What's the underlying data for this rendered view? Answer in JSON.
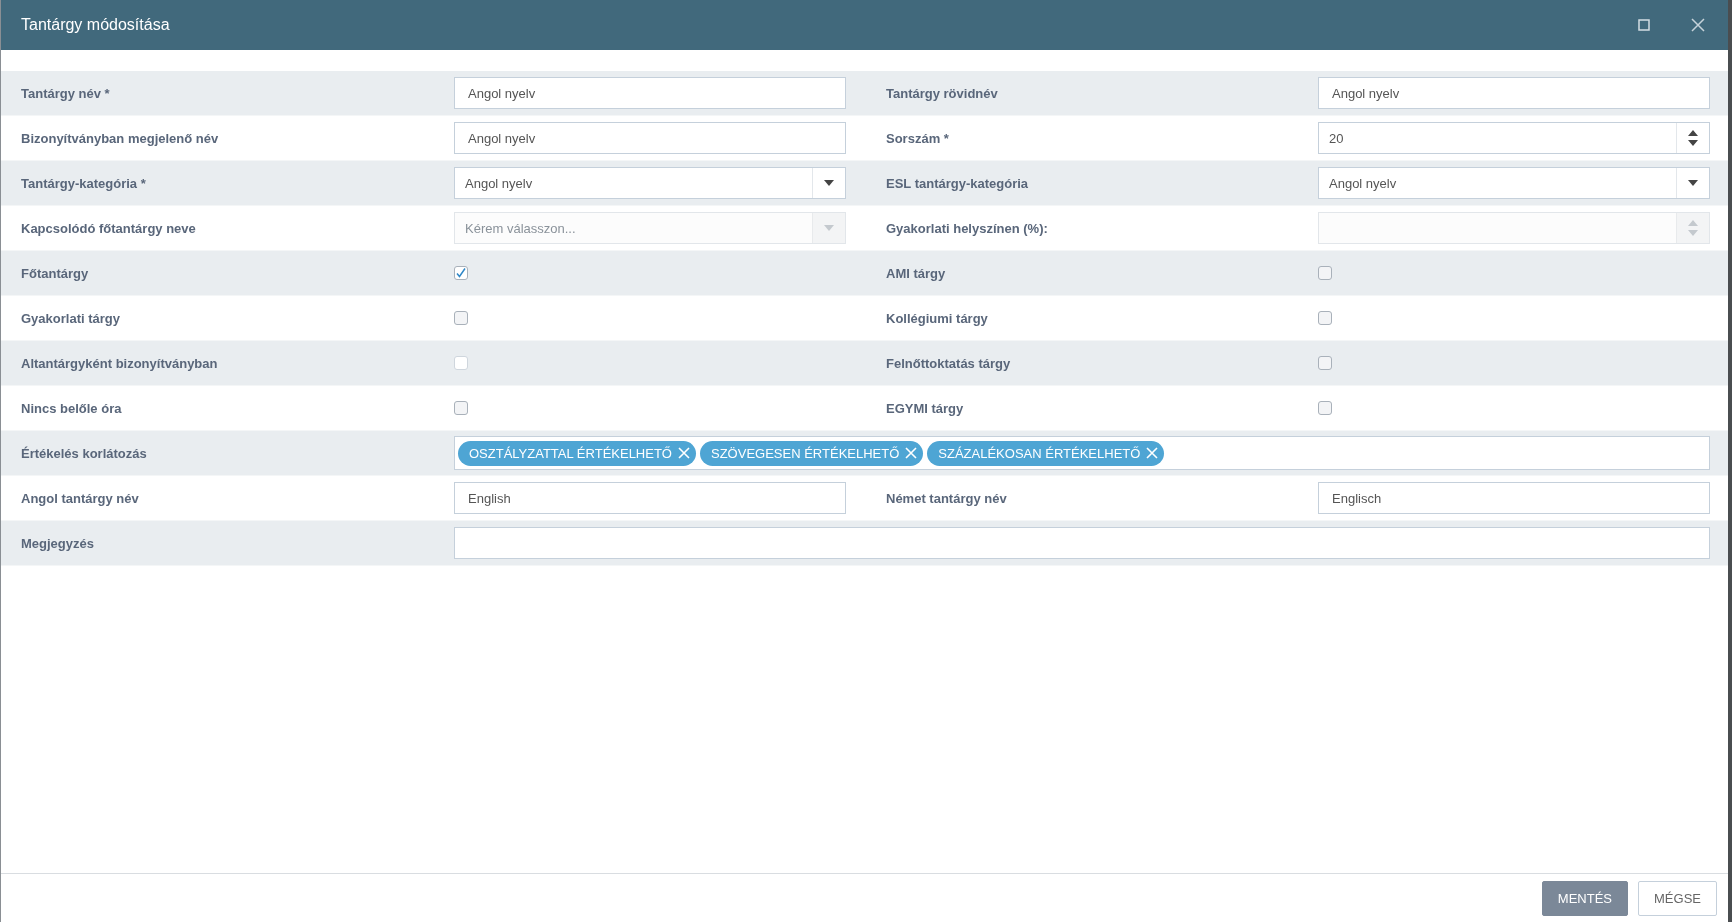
{
  "window": {
    "title": "Tantárgy módosítása"
  },
  "rows": [
    {
      "cells": [
        {
          "label": "Tantárgy név *",
          "field": {
            "kind": "text",
            "value": "Angol nyelv"
          }
        },
        {
          "label": "Tantárgy rövidnév",
          "field": {
            "kind": "text",
            "value": "Angol nyelv"
          }
        }
      ]
    },
    {
      "cells": [
        {
          "label": "Bizonyítványban megjelenő név",
          "field": {
            "kind": "text",
            "value": "Angol nyelv"
          }
        },
        {
          "label": "Sorszám *",
          "field": {
            "kind": "number",
            "value": "20",
            "disabled": false
          }
        }
      ]
    },
    {
      "cells": [
        {
          "label": "Tantárgy-kategória *",
          "field": {
            "kind": "select",
            "value": "Angol nyelv",
            "disabled": false
          }
        },
        {
          "label": "ESL tantárgy-kategória",
          "field": {
            "kind": "select",
            "value": "Angol nyelv",
            "disabled": false
          }
        }
      ]
    },
    {
      "cells": [
        {
          "label": "Kapcsolódó főtantárgy neve",
          "field": {
            "kind": "select",
            "placeholder": "Kérem válasszon...",
            "disabled": true
          }
        },
        {
          "label": "Gyakorlati helyszínen (%):",
          "field": {
            "kind": "number",
            "disabled": true
          }
        }
      ]
    },
    {
      "cells": [
        {
          "label": "Főtantárgy",
          "field": {
            "kind": "checkbox",
            "checked": true,
            "disabled": false
          }
        },
        {
          "label": "AMI tárgy",
          "field": {
            "kind": "checkbox",
            "checked": false,
            "disabled": false
          }
        }
      ]
    },
    {
      "cells": [
        {
          "label": "Gyakorlati tárgy",
          "field": {
            "kind": "checkbox",
            "checked": false,
            "disabled": false
          }
        },
        {
          "label": "Kollégiumi tárgy",
          "field": {
            "kind": "checkbox",
            "checked": false,
            "disabled": false
          }
        }
      ]
    },
    {
      "cells": [
        {
          "label": "Altantárgyként bizonyítványban",
          "field": {
            "kind": "checkbox",
            "checked": false,
            "disabled": true
          }
        },
        {
          "label": "Felnőttoktatás tárgy",
          "field": {
            "kind": "checkbox",
            "checked": false,
            "disabled": false
          }
        }
      ]
    },
    {
      "cells": [
        {
          "label": "Nincs belőle óra",
          "field": {
            "kind": "checkbox",
            "checked": false,
            "disabled": false
          }
        },
        {
          "label": "EGYMI tárgy",
          "field": {
            "kind": "checkbox",
            "checked": false,
            "disabled": false
          }
        }
      ]
    },
    {
      "cells": [
        {
          "label": "Értékelés korlátozás",
          "field": {
            "kind": "tags",
            "tags": [
              "OSZTÁLYZATTAL ÉRTÉKELHETŐ",
              "SZÖVEGESEN ÉRTÉKELHETŐ",
              "SZÁZALÉKOSAN ÉRTÉKELHETŐ"
            ]
          }
        }
      ]
    },
    {
      "cells": [
        {
          "label": "Angol tantárgy név",
          "field": {
            "kind": "text",
            "value": "English"
          }
        },
        {
          "label": "Német tantárgy név",
          "field": {
            "kind": "text",
            "value": "Englisch"
          }
        }
      ]
    },
    {
      "cells": [
        {
          "label": "Megjegyzés",
          "field": {
            "kind": "text"
          }
        }
      ]
    }
  ],
  "buttons": [
    {
      "label": "MENTÉS",
      "primary": true
    },
    {
      "label": "MÉGSE",
      "primary": false
    }
  ]
}
